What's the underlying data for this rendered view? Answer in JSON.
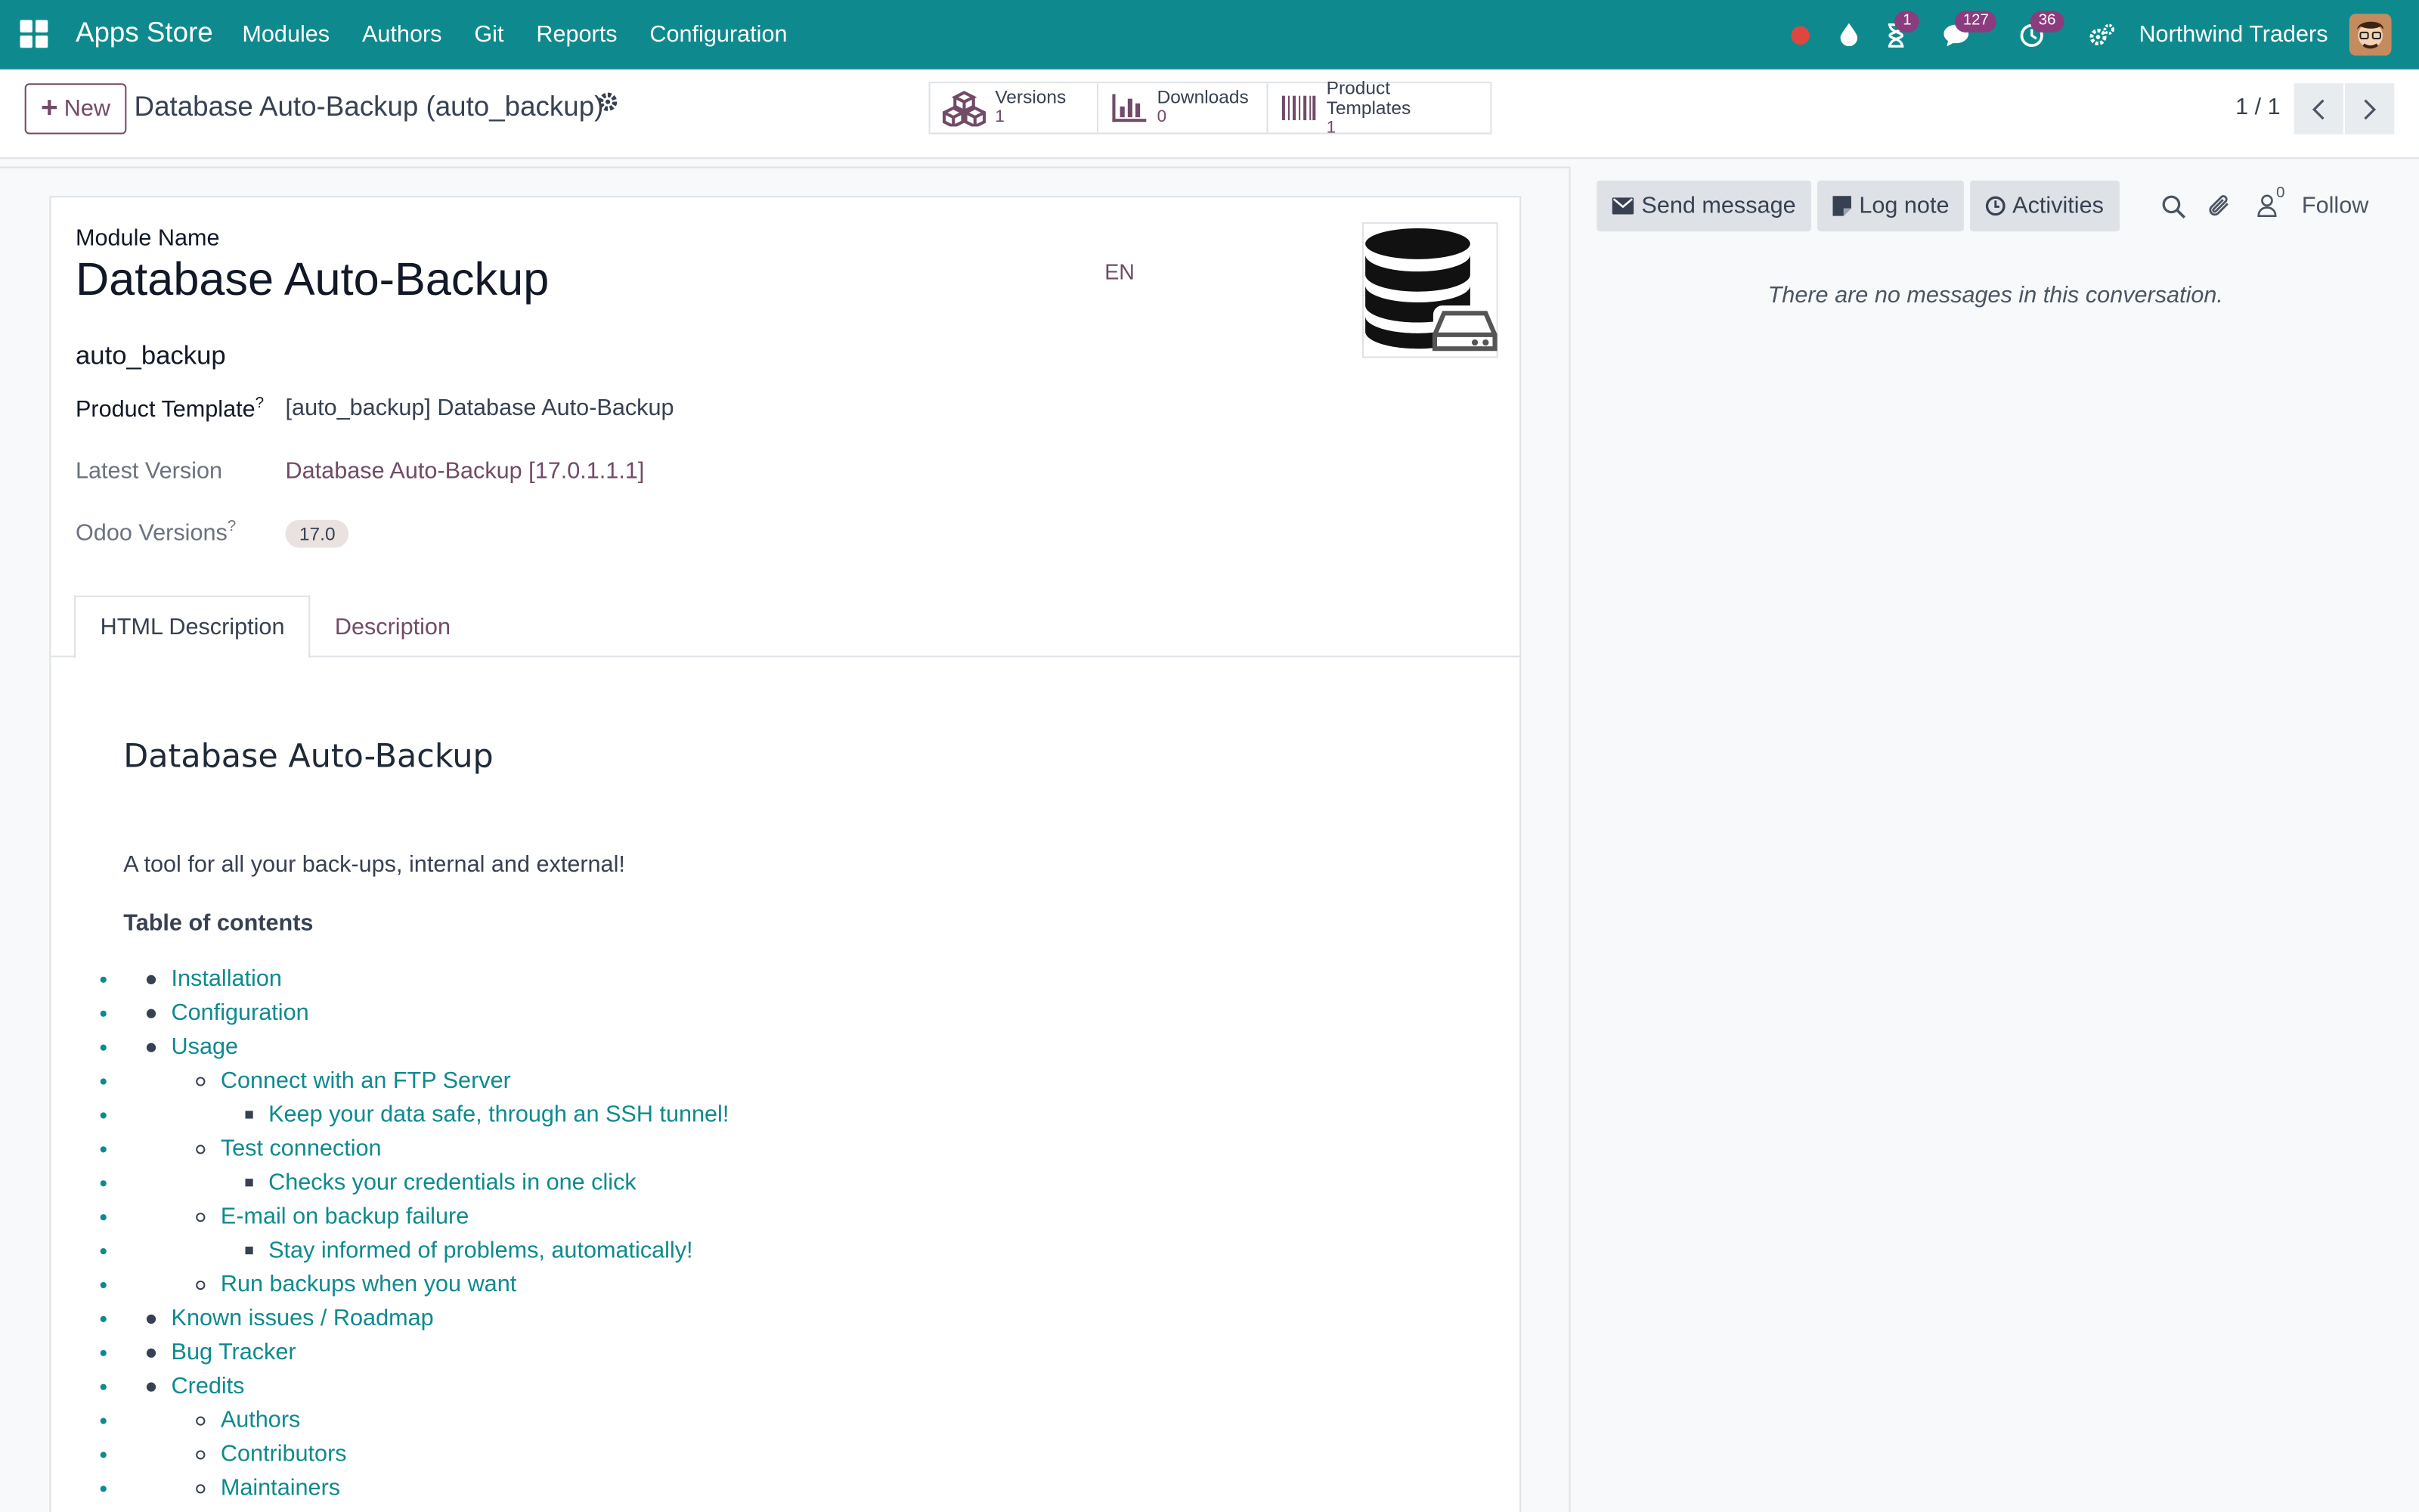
{
  "navbar": {
    "brand": "Apps Store",
    "menu": [
      "Modules",
      "Authors",
      "Git",
      "Reports",
      "Configuration"
    ],
    "badges": {
      "activity": "1",
      "messages": "127",
      "clock": "36"
    },
    "company": "Northwind Traders",
    "colors": {
      "navbar_bg": "#0e8a8e",
      "accent": "#714b67"
    }
  },
  "control": {
    "new_label": "New",
    "breadcrumb": "Database Auto-Backup (auto_backup)",
    "smart_buttons": [
      {
        "label": "Versions",
        "value": "1",
        "icon": "cubes-icon"
      },
      {
        "label": "Downloads",
        "value": "0",
        "icon": "bar-chart-icon"
      },
      {
        "label": "Product Templates",
        "value": "1",
        "icon": "barcode-icon"
      }
    ],
    "pager": "1 / 1"
  },
  "form": {
    "module_name_label": "Module Name",
    "module_name": "Database Auto-Backup",
    "lang": "EN",
    "technical_name": "auto_backup",
    "product_template_label": "Product Template",
    "product_template_value": "[auto_backup] Database Auto-Backup",
    "latest_version_label": "Latest Version",
    "latest_version_value": "Database Auto-Backup [17.0.1.1.1]",
    "odoo_versions_label": "Odoo Versions",
    "odoo_versions_tag": "17.0",
    "help_mark": "?",
    "tabs": [
      "HTML Description",
      "Description"
    ]
  },
  "description": {
    "heading": "Database Auto-Backup",
    "intro": "A tool for all your back-ups, internal and external!",
    "toc_title": "Table of contents",
    "toc": [
      {
        "level": 1,
        "text": "Installation"
      },
      {
        "level": 1,
        "text": "Configuration"
      },
      {
        "level": 1,
        "text": "Usage"
      },
      {
        "level": 2,
        "text": "Connect with an FTP Server"
      },
      {
        "level": 3,
        "text": "Keep your data safe, through an SSH tunnel!"
      },
      {
        "level": 2,
        "text": "Test connection"
      },
      {
        "level": 3,
        "text": "Checks your credentials in one click"
      },
      {
        "level": 2,
        "text": "E-mail on backup failure"
      },
      {
        "level": 3,
        "text": "Stay informed of problems, automatically!"
      },
      {
        "level": 2,
        "text": "Run backups when you want"
      },
      {
        "level": 1,
        "text": "Known issues / Roadmap"
      },
      {
        "level": 1,
        "text": "Bug Tracker"
      },
      {
        "level": 1,
        "text": "Credits"
      },
      {
        "level": 2,
        "text": "Authors"
      },
      {
        "level": 2,
        "text": "Contributors"
      },
      {
        "level": 2,
        "text": "Maintainers"
      }
    ]
  },
  "chatter": {
    "send_message": "Send message",
    "log_note": "Log note",
    "activities": "Activities",
    "followers_count": "0",
    "follow": "Follow",
    "empty": "There are no messages in this conversation."
  }
}
